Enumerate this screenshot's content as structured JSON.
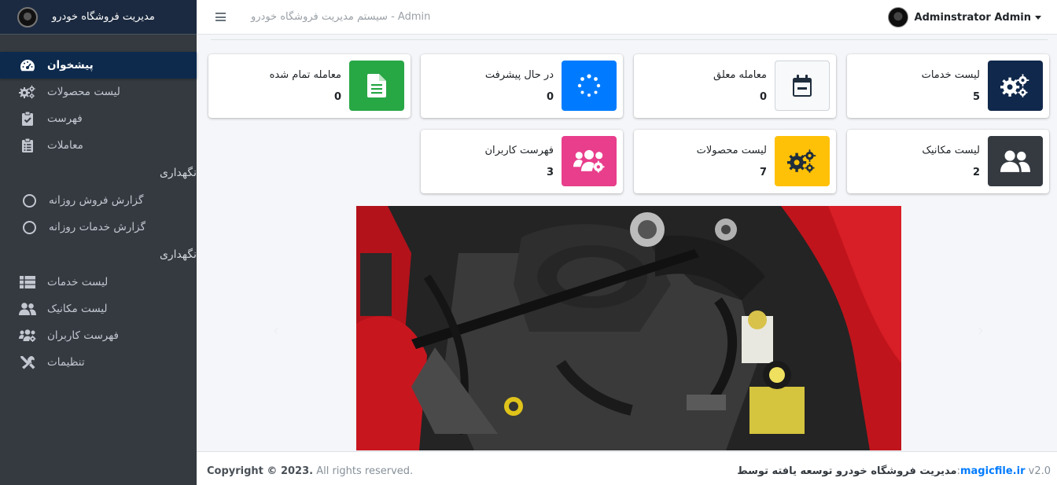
{
  "brand": {
    "title": "مدیریت فروشگاه خودرو"
  },
  "sidebar": {
    "items": [
      {
        "label": "پیشخوان",
        "icon": "tachometer-icon"
      },
      {
        "label": "لیست محصولات",
        "icon": "cogs-icon"
      },
      {
        "label": "فهرست",
        "icon": "clipboard-check-icon"
      },
      {
        "label": "معاملات",
        "icon": "clipboard-list-icon"
      }
    ],
    "section1": {
      "header": "نگهداری",
      "items": [
        {
          "label": "گزارش فروش روزانه"
        },
        {
          "label": "گزارش خدمات روزانه"
        }
      ]
    },
    "section2": {
      "header": "نگهداری",
      "items": [
        {
          "label": "لیست خدمات",
          "icon": "th-list-icon"
        },
        {
          "label": "لیست مکانیک",
          "icon": "users-icon"
        },
        {
          "label": "فهرست کاربران",
          "icon": "users-cog-icon"
        },
        {
          "label": "تنظیمات",
          "icon": "tools-icon"
        }
      ]
    }
  },
  "navbar": {
    "title": "سیستم مدیریت فروشگاه خودرو - Admin",
    "user": "Adminstrator Admin"
  },
  "boxes": [
    {
      "label": "لیست خدمات",
      "value": "5",
      "color": "#10284b",
      "icon": "cogs-icon"
    },
    {
      "label": "معامله معلق",
      "value": "0",
      "color": "#f8f9fa",
      "icon": "calendar-minus-icon"
    },
    {
      "label": "در حال پیشرفت",
      "value": "0",
      "color": "#007bff",
      "icon": "spinner-icon"
    },
    {
      "label": "معامله تمام شده",
      "value": "0",
      "color": "#28a745",
      "icon": "file-check-icon"
    },
    {
      "label": "لیست مکانیک",
      "value": "2",
      "color": "#343a40",
      "icon": "users-icon"
    },
    {
      "label": "لیست محصولات",
      "value": "7",
      "color": "#ffc107",
      "icon": "cogs-icon"
    },
    {
      "label": "فهرست کاربران",
      "value": "3",
      "color": "#e83e8c",
      "icon": "users-cog-icon"
    }
  ],
  "footer": {
    "copyright_bold": "Copyright © 2023.",
    "copyright_rest": " All rights reserved.",
    "credit_text": "مدیریت فروشگاه خودرو توسعه یافته توسط",
    "credit_link": "magicfile.ir",
    "version": " v2.0"
  }
}
